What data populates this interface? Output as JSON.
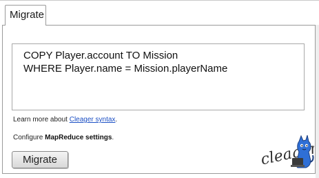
{
  "tab": {
    "label": "Migrate"
  },
  "query": {
    "lines": [
      "COPY Player.account TO Mission",
      "WHERE Player.name = Mission.playerName"
    ]
  },
  "learn_more": {
    "prefix": "Learn more about ",
    "link": "Cleager syntax",
    "suffix": "."
  },
  "configure": {
    "prefix": "Configure ",
    "bold": "MapReduce settings",
    "suffix": "."
  },
  "migrate_button": {
    "label": "Migrate"
  },
  "logo": {
    "text": "cleager"
  },
  "colors": {
    "link": "#1b4fc4",
    "border": "#9a9a9a",
    "logo_blue": "#2f6fd6"
  }
}
